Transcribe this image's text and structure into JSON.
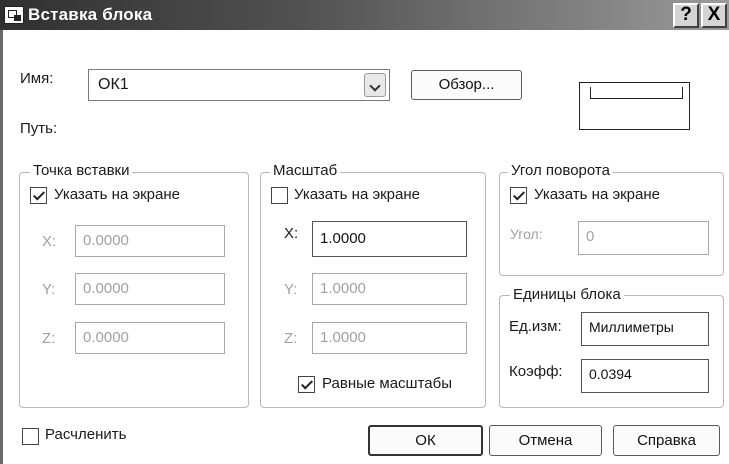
{
  "window": {
    "title": "Вставка блока",
    "help_glyph": "?",
    "close_glyph": "X"
  },
  "name": {
    "label": "Имя:",
    "value": "ОК1",
    "browse_label": "Обзор..."
  },
  "path": {
    "label": "Путь:"
  },
  "insertion_point": {
    "title": "Точка вставки",
    "specify_label": "Указать на экране",
    "specify_checked": true,
    "x_label": "X:",
    "x_value": "0.0000",
    "y_label": "Y:",
    "y_value": "0.0000",
    "z_label": "Z:",
    "z_value": "0.0000"
  },
  "scale": {
    "title": "Масштаб",
    "specify_label": "Указать на экране",
    "specify_checked": false,
    "x_label": "X:",
    "x_value": "1.0000",
    "y_label": "Y:",
    "y_value": "1.0000",
    "z_label": "Z:",
    "z_value": "1.0000",
    "uniform_label": "Равные масштабы",
    "uniform_checked": true
  },
  "rotation": {
    "title": "Угол поворота",
    "specify_label": "Указать на экране",
    "specify_checked": true,
    "angle_label": "Угол:",
    "angle_value": "0"
  },
  "block_units": {
    "title": "Единицы блока",
    "unit_label": "Ед.изм:",
    "unit_value": "Миллиметры",
    "factor_label": "Коэфф:",
    "factor_value": "0.0394"
  },
  "explode": {
    "label": "Расчленить",
    "checked": false
  },
  "buttons": {
    "ok": "ОК",
    "cancel": "Отмена",
    "help": "Справка"
  }
}
